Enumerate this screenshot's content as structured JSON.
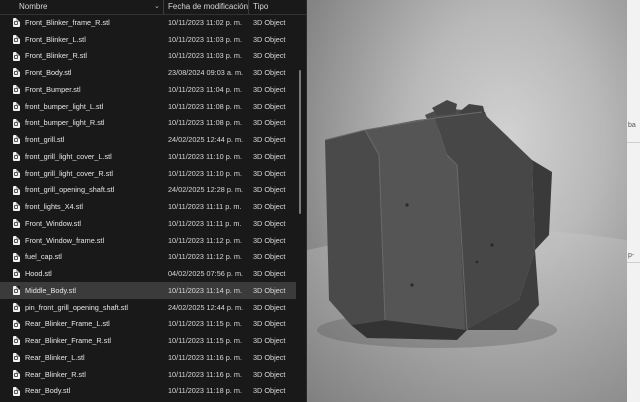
{
  "columns": {
    "name": "Nombre",
    "date": "Fecha de modificación",
    "type": "Tipo"
  },
  "files": [
    {
      "name": "Front_Blinker_frame_R.stl",
      "date": "10/11/2023 11:02 p. m.",
      "type": "3D Object"
    },
    {
      "name": "Front_Blinker_L.stl",
      "date": "10/11/2023 11:03 p. m.",
      "type": "3D Object"
    },
    {
      "name": "Front_Blinker_R.stl",
      "date": "10/11/2023 11:03 p. m.",
      "type": "3D Object"
    },
    {
      "name": "Front_Body.stl",
      "date": "23/08/2024 09:03 a. m.",
      "type": "3D Object"
    },
    {
      "name": "Front_Bumper.stl",
      "date": "10/11/2023 11:04 p. m.",
      "type": "3D Object"
    },
    {
      "name": "front_bumper_light_L.stl",
      "date": "10/11/2023 11:08 p. m.",
      "type": "3D Object"
    },
    {
      "name": "front_bumper_light_R.stl",
      "date": "10/11/2023 11:08 p. m.",
      "type": "3D Object"
    },
    {
      "name": "front_grill.stl",
      "date": "24/02/2025 12:44 p. m.",
      "type": "3D Object"
    },
    {
      "name": "front_grill_light_cover_L.stl",
      "date": "10/11/2023 11:10 p. m.",
      "type": "3D Object"
    },
    {
      "name": "front_grill_light_cover_R.stl",
      "date": "10/11/2023 11:10 p. m.",
      "type": "3D Object"
    },
    {
      "name": "front_grill_opening_shaft.stl",
      "date": "24/02/2025 12:28 p. m.",
      "type": "3D Object"
    },
    {
      "name": "front_lights_X4.stl",
      "date": "10/11/2023 11:11 p. m.",
      "type": "3D Object"
    },
    {
      "name": "Front_Window.stl",
      "date": "10/11/2023 11:11 p. m.",
      "type": "3D Object"
    },
    {
      "name": "Front_Window_frame.stl",
      "date": "10/11/2023 11:12 p. m.",
      "type": "3D Object"
    },
    {
      "name": "fuel_cap.stl",
      "date": "10/11/2023 11:12 p. m.",
      "type": "3D Object"
    },
    {
      "name": "Hood.stl",
      "date": "04/02/2025 07:56 p. m.",
      "type": "3D Object"
    },
    {
      "name": "Middle_Body.stl",
      "date": "10/11/2023 11:14 p. m.",
      "type": "3D Object"
    },
    {
      "name": "pin_front_grill_opening_shaft.stl",
      "date": "24/02/2025 12:44 p. m.",
      "type": "3D Object"
    },
    {
      "name": "Rear_Blinker_Frame_L.stl",
      "date": "10/11/2023 11:15 p. m.",
      "type": "3D Object"
    },
    {
      "name": "Rear_Blinker_Frame_R.stl",
      "date": "10/11/2023 11:15 p. m.",
      "type": "3D Object"
    },
    {
      "name": "Rear_Blinker_L.stl",
      "date": "10/11/2023 11:16 p. m.",
      "type": "3D Object"
    },
    {
      "name": "Rear_Blinker_R.stl",
      "date": "10/11/2023 11:16 p. m.",
      "type": "3D Object"
    },
    {
      "name": "Rear_Body.stl",
      "date": "10/11/2023 11:18 p. m.",
      "type": "3D Object"
    }
  ],
  "selected_index": 16,
  "right_strip": {
    "text1": "ba",
    "text2": "p-"
  },
  "colors": {
    "selected_row": "#3b3b3b",
    "background": "#191919",
    "text": "#e6e6e6"
  },
  "icons": {
    "sort": "chevron-down-icon",
    "file": "file-3d-icon"
  }
}
